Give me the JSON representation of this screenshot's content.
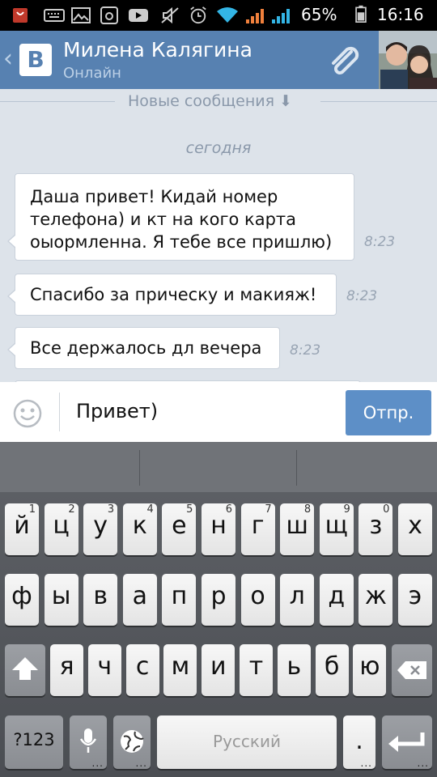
{
  "status_bar": {
    "battery": "65%",
    "time": "16:16"
  },
  "header": {
    "name": "Милена Калягина",
    "status": "Онлайн"
  },
  "chat": {
    "new_messages_label": "Новые сообщения ⬇",
    "date_label": "сегодня",
    "messages": [
      {
        "lines": [
          "Даша привет! Кидай номер",
          "телефона) и кт на кого карта",
          "оыормленна. Я тебе все пришлю)"
        ],
        "time": "8:23"
      },
      {
        "lines": [
          "Спасибо за прическу и макияж!"
        ],
        "time": "8:23"
      },
      {
        "lines": [
          "Все держалось дл вечера"
        ],
        "time": "8:23"
      }
    ]
  },
  "input": {
    "value": "Привет)",
    "send_label": "Отпр."
  },
  "keyboard": {
    "row1": [
      {
        "k": "й",
        "h": "1"
      },
      {
        "k": "ц",
        "h": "2"
      },
      {
        "k": "у",
        "h": "3"
      },
      {
        "k": "к",
        "h": "4"
      },
      {
        "k": "е",
        "h": "5"
      },
      {
        "k": "н",
        "h": "6"
      },
      {
        "k": "г",
        "h": "7"
      },
      {
        "k": "ш",
        "h": "8"
      },
      {
        "k": "щ",
        "h": "9"
      },
      {
        "k": "з",
        "h": "0"
      },
      {
        "k": "х",
        "h": ""
      }
    ],
    "row2": [
      "ф",
      "ы",
      "в",
      "а",
      "п",
      "р",
      "о",
      "л",
      "д",
      "ж",
      "э"
    ],
    "row3": [
      "я",
      "ч",
      "с",
      "м",
      "и",
      "т",
      "ь",
      "б",
      "ю"
    ],
    "symbols_label": "?123",
    "space_label": "Русский",
    "period_label": "."
  }
}
